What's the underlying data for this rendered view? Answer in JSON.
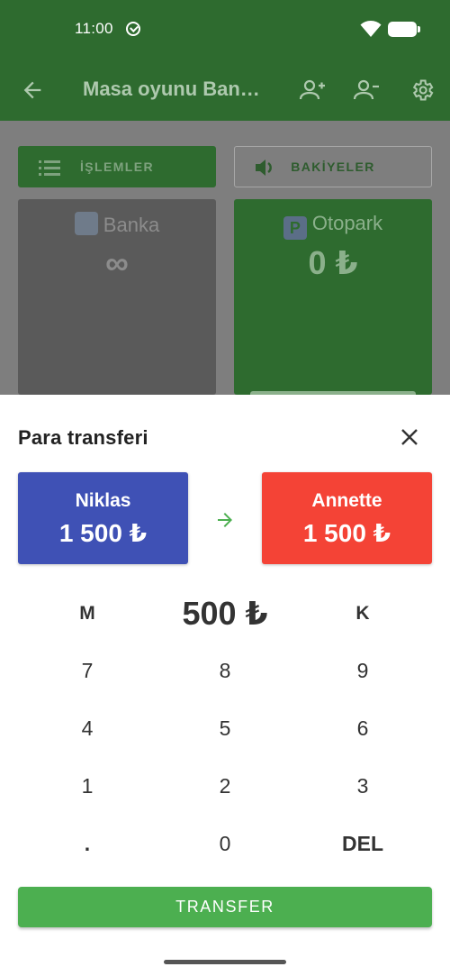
{
  "status_bar": {
    "time": "11:00"
  },
  "app_bar": {
    "title": "Masa oyunu Ban…"
  },
  "background": {
    "operations_button": "İŞLEMLER",
    "balances_button": "BAKİYELER",
    "cards": [
      {
        "name": "Banka",
        "amount": "∞"
      },
      {
        "name": "Otopark",
        "amount": "0 ₺"
      }
    ]
  },
  "sheet": {
    "title": "Para transferi",
    "from": {
      "name": "Niklas",
      "amount": "1 500 ₺"
    },
    "to": {
      "name": "Annette",
      "amount": "1 500 ₺"
    },
    "amount": "500 ₺",
    "keypad": {
      "m": "M",
      "k": "K",
      "seven": "7",
      "eight": "8",
      "nine": "9",
      "four": "4",
      "five": "5",
      "six": "6",
      "one": "1",
      "two": "2",
      "three": "3",
      "dot": ".",
      "zero": "0",
      "del": "DEL"
    },
    "transfer_button": "TRANSFER"
  },
  "colors": {
    "app_green": "#2e6b2f",
    "from_blue": "#3f51b5",
    "to_red": "#f44336",
    "transfer_green": "#4caf50"
  },
  "icons": [
    "download-icon",
    "wifi-icon",
    "battery-icon",
    "back-arrow-icon",
    "add-person-icon",
    "remove-person-icon",
    "settings-gear-icon",
    "list-icon",
    "volume-icon",
    "bank-icon",
    "parking-icon",
    "close-icon",
    "arrow-right-icon"
  ]
}
